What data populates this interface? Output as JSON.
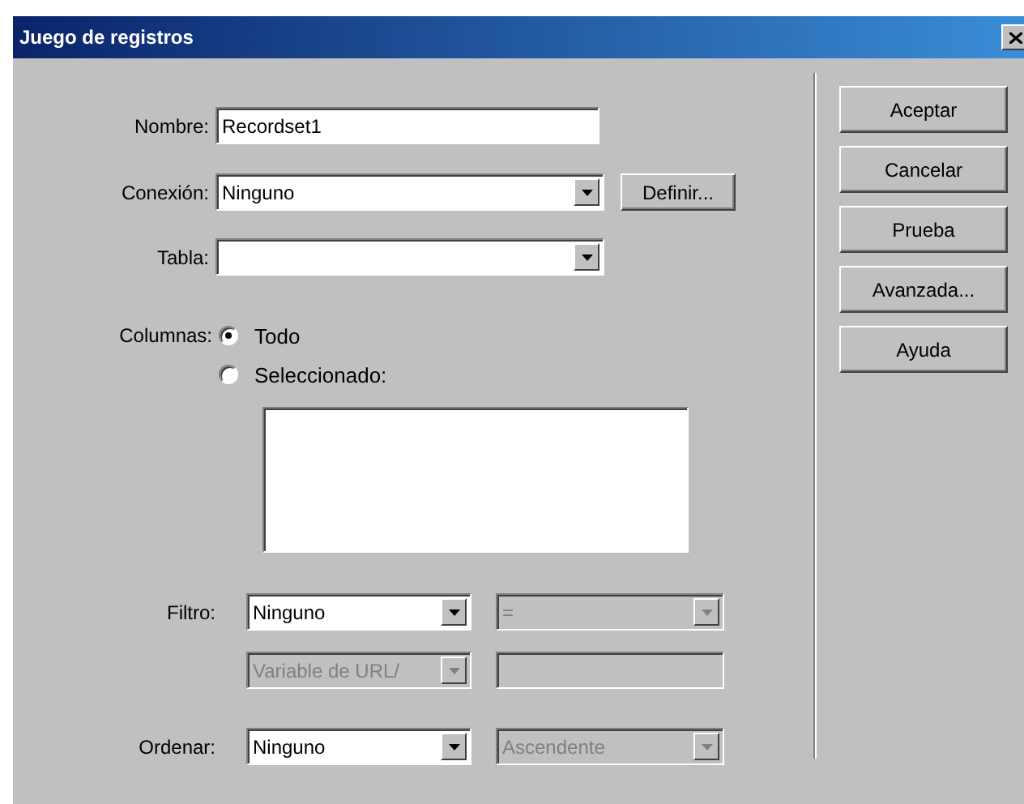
{
  "window": {
    "title": "Juego de registros"
  },
  "name": {
    "label": "Nombre:",
    "value": "Recordset1"
  },
  "connection": {
    "label": "Conexión:",
    "value": "Ninguno",
    "button": "Definir..."
  },
  "table": {
    "label": "Tabla:"
  },
  "columns": {
    "label": "Columnas:",
    "options": [
      {
        "label": "Todo",
        "selected": true
      },
      {
        "label": "Seleccionado:",
        "selected": false
      }
    ]
  },
  "filter": {
    "label": "Filtro:",
    "column": {
      "value": "Ninguno",
      "disabled": false
    },
    "operator": {
      "value": "=",
      "disabled": true
    },
    "source": {
      "value": "Variable de URL/",
      "disabled": true
    },
    "text": {
      "disabled": true
    }
  },
  "sort": {
    "label": "Ordenar:",
    "column": {
      "value": "Ninguno",
      "disabled": false
    },
    "direction": {
      "value": "Ascendente",
      "disabled": true
    }
  },
  "buttons": [
    "Aceptar",
    "Cancelar",
    "Prueba",
    "Avanzada...",
    "Ayuda"
  ]
}
